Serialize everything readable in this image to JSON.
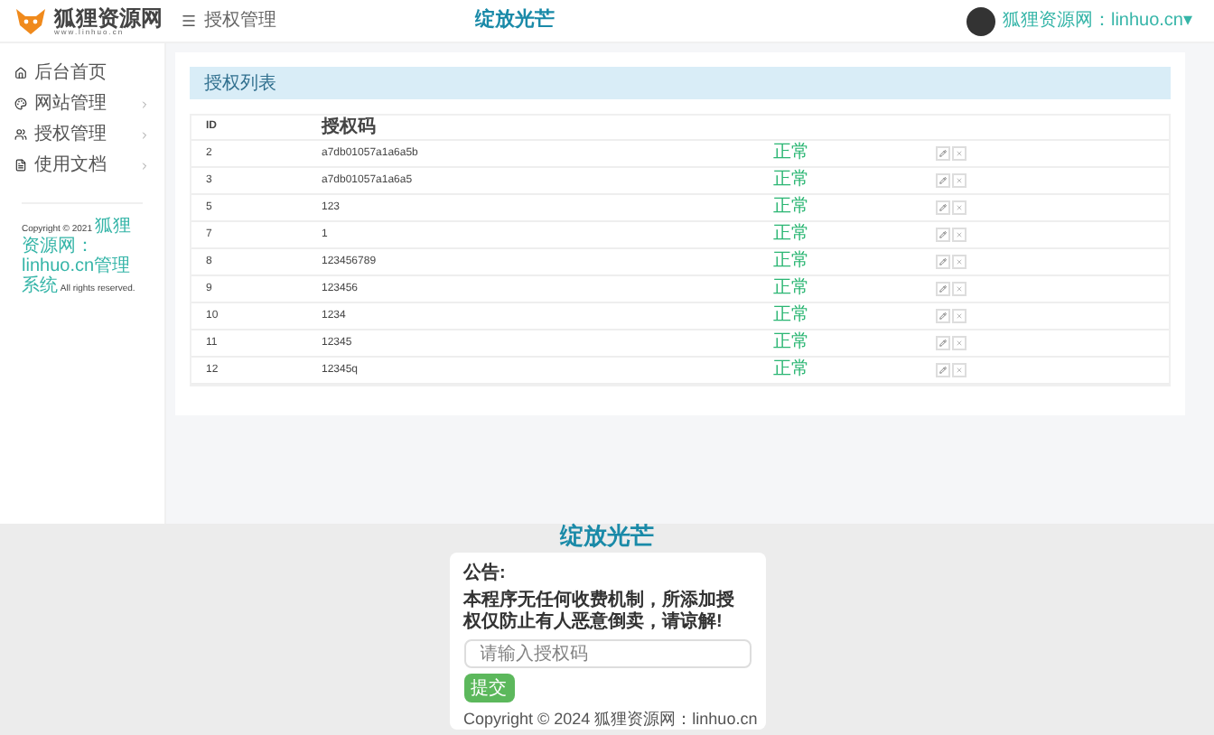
{
  "logo": {
    "name": "狐狸资源网",
    "url": "www.linhuo.cn"
  },
  "header": {
    "page_title": "授权管理",
    "banner": "绽放光芒",
    "user": "狐狸资源网：linhuo.cn▾"
  },
  "sidebar": {
    "items": [
      {
        "label": "后台首页",
        "kind": "link"
      },
      {
        "label": "网站管理",
        "kind": "menu"
      },
      {
        "label": "授权管理",
        "kind": "menu"
      },
      {
        "label": "使用文档",
        "kind": "menu"
      }
    ],
    "copyright": {
      "before": "Copyright © 2021 ",
      "link": "狐狸资源网：linhuo.cn管理系统",
      "after": " All rights reserved."
    }
  },
  "card": {
    "title": "授权列表",
    "columns": [
      "ID",
      "授权码"
    ],
    "rows": [
      {
        "id": "2",
        "code": "a7db01057a1a6a5b",
        "status": "正常"
      },
      {
        "id": "3",
        "code": "a7db01057a1a6a5",
        "status": "正常"
      },
      {
        "id": "5",
        "code": "123",
        "status": "正常"
      },
      {
        "id": "7",
        "code": "1",
        "status": "正常"
      },
      {
        "id": "8",
        "code": "123456789",
        "status": "正常"
      },
      {
        "id": "9",
        "code": "123456",
        "status": "正常"
      },
      {
        "id": "10",
        "code": "1234",
        "status": "正常"
      },
      {
        "id": "11",
        "code": "12345",
        "status": "正常"
      },
      {
        "id": "12",
        "code": "12345q",
        "status": "正常"
      }
    ]
  },
  "query": {
    "banner": "绽放光芒",
    "notice_title": "公告:",
    "notice": "本程序无任何收费机制，所添加授权仅防止有人恶意倒卖，请谅解!",
    "placeholder": "请输入授权码",
    "button": "提交",
    "footer": "Copyright © 2024 狐狸资源网：linhuo.cn"
  }
}
